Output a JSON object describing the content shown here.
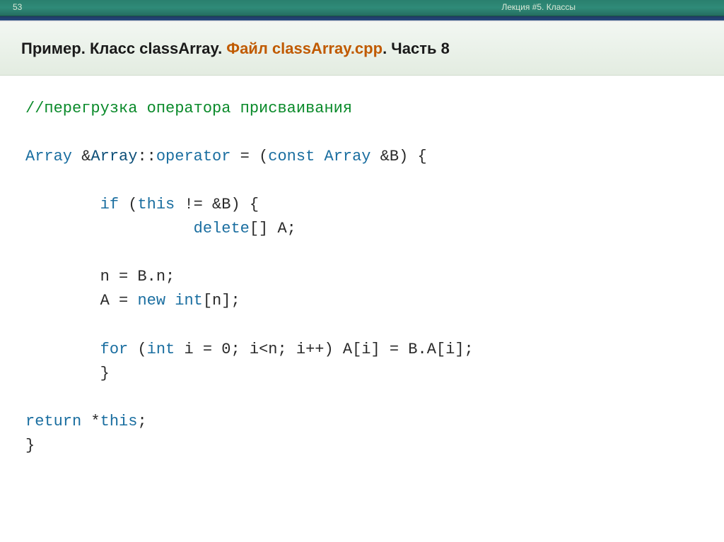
{
  "meta": {
    "slide_number": "53",
    "lecture": "Лекция #5. Классы"
  },
  "heading": {
    "part1": "Пример. Класс classArray. ",
    "accent": "Файл classArray.cpp",
    "part2": ". Часть 8"
  },
  "code": {
    "l1_comment": "//перегрузка оператора присваивания",
    "l3_t1": "Array",
    "l3_t2": " &",
    "l3_t3": "Array",
    "l3_t4": "::",
    "l3_t5": "operator",
    "l3_t6": " = (",
    "l3_t7": "const",
    "l3_t8": " ",
    "l3_t9": "Array",
    "l3_t10": " &B) {",
    "l5_t1": "        if",
    "l5_t2": " (",
    "l5_t3": "this",
    "l5_t4": " != &B) {",
    "l6_t1": "                  delete",
    "l6_t2": "[] A;",
    "l8": "        n = B.n;",
    "l9_t1": "        A = ",
    "l9_t2": "new",
    "l9_t3": " ",
    "l9_t4": "int",
    "l9_t5": "[n];",
    "l11_t1": "        for",
    "l11_t2": " (",
    "l11_t3": "int",
    "l11_t4": " i = 0; i<n; i++) A[i] = B.A[i];",
    "l12": "        }",
    "l14_t1": "return",
    "l14_t2": " *",
    "l14_t3": "this",
    "l14_t4": ";",
    "l15": "}"
  }
}
